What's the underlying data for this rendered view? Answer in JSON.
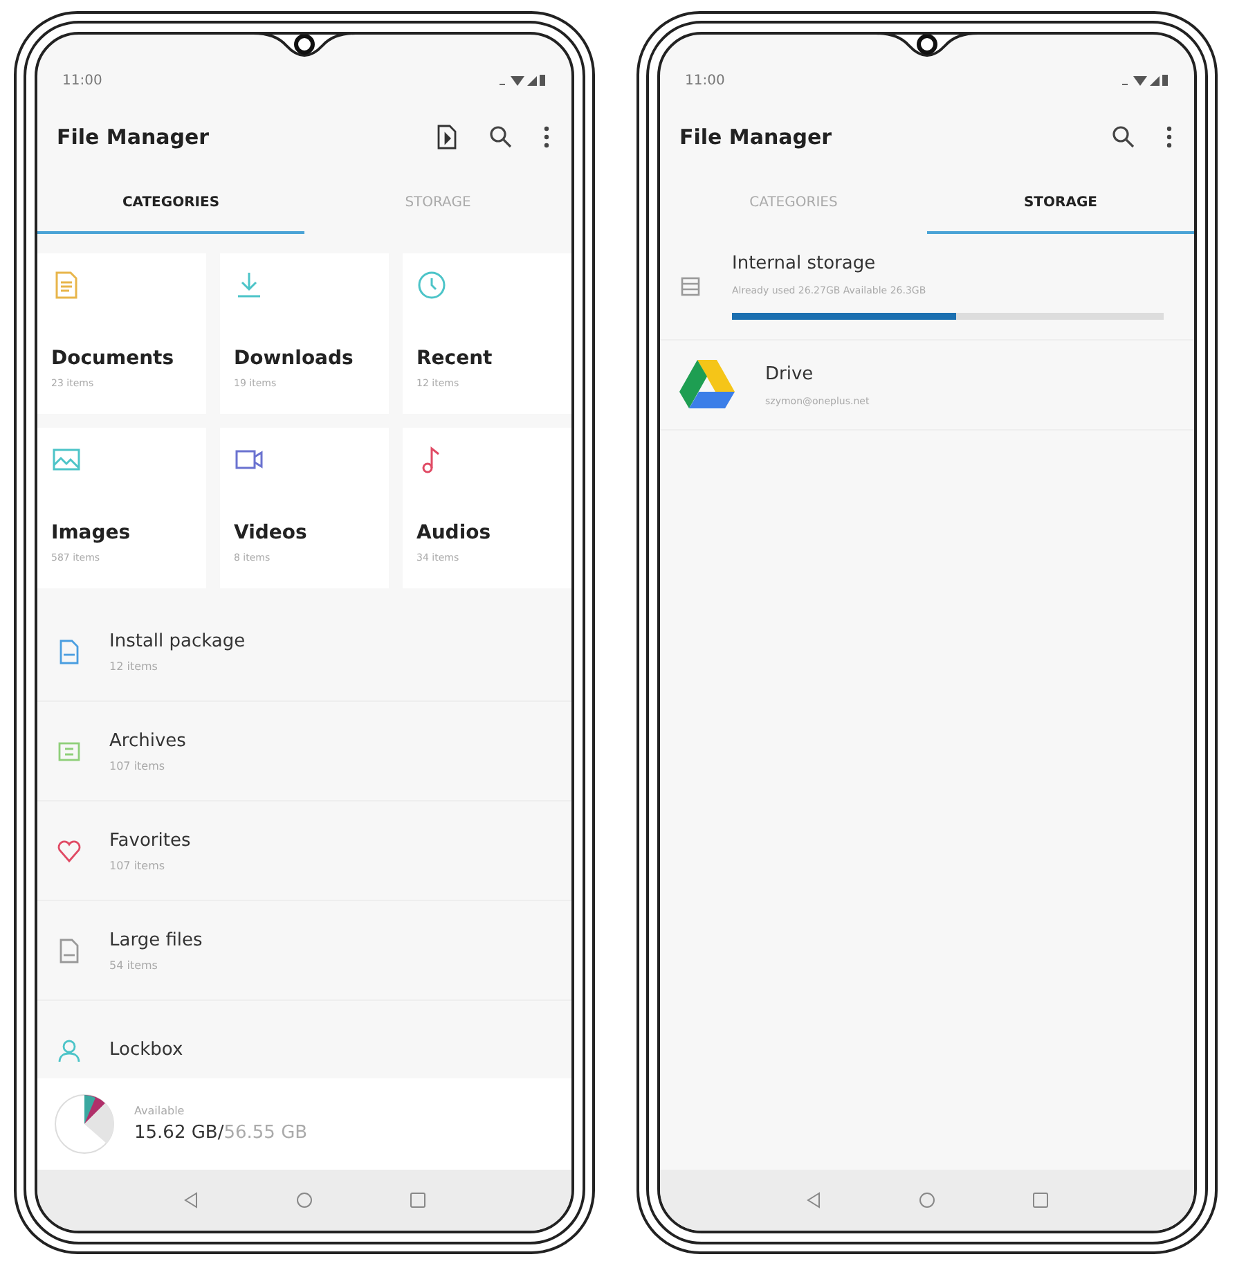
{
  "phones": [
    {
      "kind": "categories",
      "status_time": "11:00",
      "title": "File Manager",
      "tabs": [
        {
          "label": "CATEGORIES",
          "selected": true
        },
        {
          "label": "STORAGE",
          "selected": false
        }
      ],
      "categories": [
        {
          "kind": "document",
          "name": "Documents",
          "count": "23 items"
        },
        {
          "kind": "download",
          "name": "Downloads",
          "count": "19 items"
        },
        {
          "kind": "recent",
          "name": "Recent",
          "count": "12 items"
        },
        {
          "kind": "image",
          "name": "Images",
          "count": "587 items"
        },
        {
          "kind": "video",
          "name": "Videos",
          "count": "8 items"
        },
        {
          "kind": "audio",
          "name": "Audios",
          "count": "34 items"
        }
      ],
      "list": [
        {
          "kind": "package",
          "name": "Install package",
          "count": "12 items"
        },
        {
          "kind": "archive",
          "name": "Archives",
          "count": "107 items"
        },
        {
          "kind": "favorite",
          "name": "Favorites",
          "count": "107 items"
        },
        {
          "kind": "large",
          "name": "Large files",
          "count": "54 items"
        },
        {
          "kind": "lock",
          "name": "Lockbox"
        }
      ],
      "summary": {
        "label": "Available",
        "free": "15.62 GB/",
        "total": "56.55 GB"
      }
    },
    {
      "kind": "storage",
      "status_time": "11:00",
      "title": "File Manager",
      "tabs": [
        {
          "label": "CATEGORIES",
          "selected": false
        },
        {
          "label": "STORAGE",
          "selected": true
        }
      ],
      "storages": [
        {
          "kind": "internal",
          "name": "Internal storage",
          "detail": "Already used 26.27GB Available 26.3GB",
          "level": 0.52
        },
        {
          "kind": "drive",
          "name": "Drive",
          "detail": "szymon@oneplus.net"
        }
      ]
    }
  ]
}
